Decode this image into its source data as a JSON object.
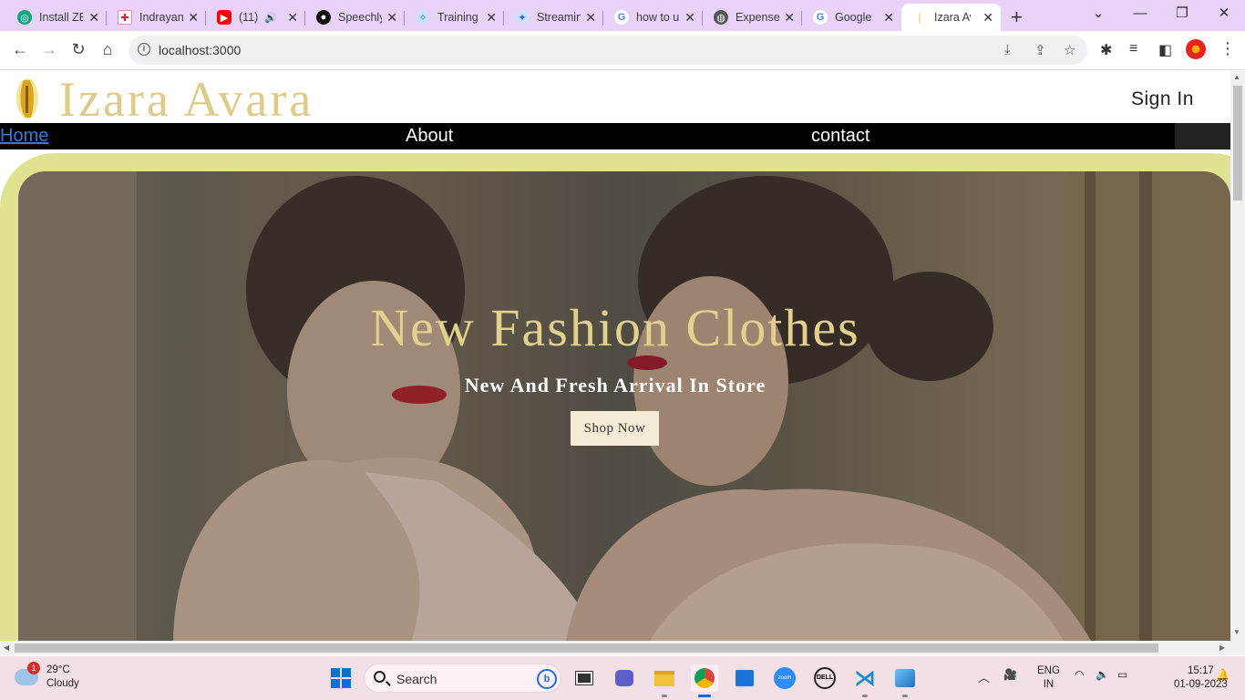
{
  "browser": {
    "tabs": [
      {
        "title": "Install ZE",
        "icon": "openai-icon",
        "color": "#10a37f"
      },
      {
        "title": "Indrayani",
        "icon": "page-icon",
        "color": "#c24"
      },
      {
        "title": "(11)",
        "icon": "youtube-icon",
        "color": "#ff0000"
      },
      {
        "title": "Speechly",
        "icon": "github-icon",
        "color": "#111"
      },
      {
        "title": "Training",
        "icon": "colab-icon",
        "color": "#3b7ddd"
      },
      {
        "title": "Streamin",
        "icon": "streamlit-icon",
        "color": "#2a62d8"
      },
      {
        "title": "how to u",
        "icon": "google-icon",
        "color": "#4285f4"
      },
      {
        "title": "Expense",
        "icon": "globe-icon",
        "color": "#555"
      },
      {
        "title": "Google",
        "icon": "google-icon",
        "color": "#4285f4"
      },
      {
        "title": "Izara Av",
        "icon": "site-logo-icon",
        "color": "#e2c24b"
      }
    ],
    "url": "localhost:3000"
  },
  "site": {
    "brand": "Izara Avara",
    "signin": "Sign In",
    "nav": {
      "home": "Home",
      "about": "About",
      "contact": "contact"
    },
    "hero": {
      "title": "New Fashion Clothes",
      "subtitle": "New And Fresh Arrival In Store",
      "cta": "Shop Now"
    }
  },
  "taskbar": {
    "weather_temp": "29°C",
    "weather_desc": "Cloudy",
    "weather_badge": "1",
    "search_label": "Search",
    "lang_line1": "ENG",
    "lang_line2": "IN",
    "time": "15:17",
    "date": "01-09-2023"
  },
  "colors": {
    "brand_gold": "#dccb8a",
    "frame_green": "#dfe28e",
    "tabstrip": "#e8d2f7",
    "taskbar": "#f3dfe6"
  }
}
